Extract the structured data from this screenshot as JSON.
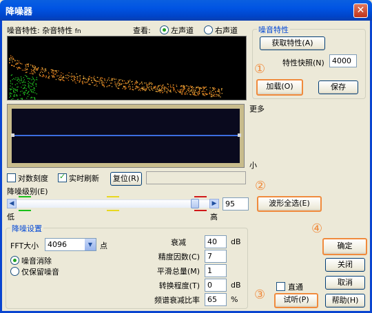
{
  "window": {
    "title": "降噪器",
    "close_glyph": "✕"
  },
  "top": {
    "noise_label": "噪音特性: 杂音特性",
    "noise_suffix": "fn",
    "view_label": "查看:",
    "left_channel": "左声道",
    "right_channel": "右声道",
    "selected_channel": "left"
  },
  "noise_group": {
    "title": "噪音特性",
    "get_btn": "获取特性(A)",
    "snapshot_label": "特性快照(N)",
    "snapshot_value": "4000",
    "load_btn": "加载(O)",
    "save_btn": "保存"
  },
  "curve": {
    "more_label": "更多",
    "less_label": "小"
  },
  "options": {
    "log_scale_label": "对数刻度",
    "log_scale_checked": false,
    "realtime_label": "实时刷新",
    "realtime_checked": true,
    "reset_btn": "复位(R)"
  },
  "level": {
    "label": "降噪级别(E)",
    "value": "95",
    "low_label": "低",
    "high_label": "高",
    "select_all_btn": "波形全选(E)"
  },
  "settings": {
    "title": "降噪设置",
    "fft_label": "FFT大小",
    "fft_value": "4096",
    "fft_unit": "点",
    "mode_remove": "噪音消除",
    "mode_keep": "仅保留噪音",
    "selected_mode": "remove",
    "params": [
      {
        "label": "衰减",
        "value": "40",
        "unit": "dB"
      },
      {
        "label": "精度因数(C)",
        "value": "7",
        "unit": ""
      },
      {
        "label": "平滑总量(M)",
        "value": "1",
        "unit": ""
      },
      {
        "label": "转换程度(T)",
        "value": "0",
        "unit": "dB"
      },
      {
        "label": "频谱衰减比率",
        "value": "65",
        "unit": "%"
      }
    ]
  },
  "bottom": {
    "bypass_label": "直通",
    "bypass_checked": false,
    "preview_btn": "试听(P)",
    "ok_btn": "确定",
    "close_btn": "关闭",
    "cancel_btn": "取消",
    "help_btn": "帮助(H)"
  },
  "markers": {
    "m1": "①",
    "m2": "②",
    "m3": "③",
    "m4": "④"
  },
  "colors": {
    "title_bar": "#0054e3",
    "highlight": "#f08a3c",
    "graph_bg": "#000000",
    "curve_bg": "#0a0a1e",
    "curve_line": "#3c6ee0"
  }
}
